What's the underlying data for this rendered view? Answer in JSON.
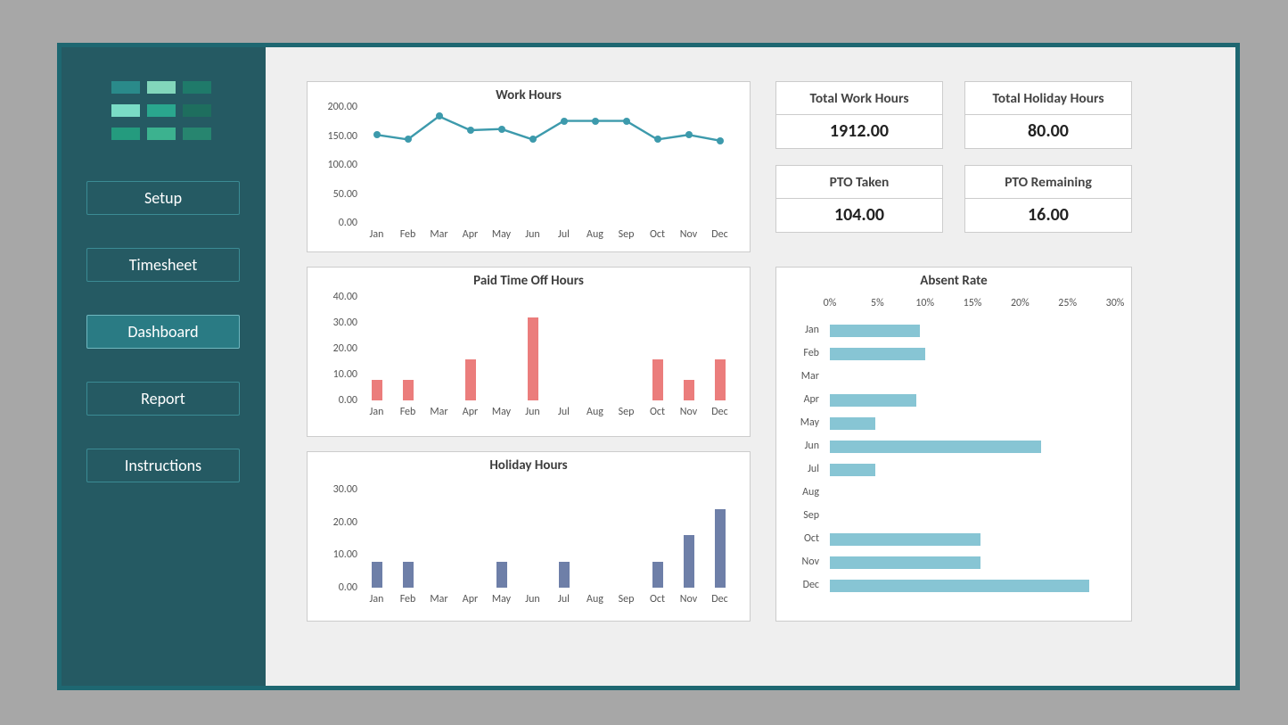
{
  "sidebar": {
    "items": [
      {
        "label": "Setup"
      },
      {
        "label": "Timesheet"
      },
      {
        "label": "Dashboard",
        "active": true
      },
      {
        "label": "Report"
      },
      {
        "label": "Instructions"
      }
    ]
  },
  "kpis": [
    {
      "title": "Total Work Hours",
      "value": "1912.00"
    },
    {
      "title": "Total Holiday Hours",
      "value": "80.00"
    },
    {
      "title": "PTO Taken",
      "value": "104.00"
    },
    {
      "title": "PTO Remaining",
      "value": "16.00"
    }
  ],
  "months": [
    "Jan",
    "Feb",
    "Mar",
    "Apr",
    "May",
    "Jun",
    "Jul",
    "Aug",
    "Sep",
    "Oct",
    "Nov",
    "Dec"
  ],
  "colors": {
    "line": "#3d9aac",
    "pto_bar": "#eb7d7c",
    "holiday_bar": "#6e7fa8",
    "absent_bar": "#87c5d4"
  },
  "chart_data": [
    {
      "type": "line",
      "title": "Work Hours",
      "categories": [
        "Jan",
        "Feb",
        "Mar",
        "Apr",
        "May",
        "Jun",
        "Jul",
        "Aug",
        "Sep",
        "Oct",
        "Nov",
        "Dec"
      ],
      "values": [
        152,
        144,
        184,
        160,
        162,
        144,
        176,
        176,
        176,
        144,
        152,
        142
      ],
      "xlabel": "",
      "ylabel": "",
      "ylim": [
        0,
        200
      ],
      "yticks": [
        0.0,
        50.0,
        100.0,
        150.0,
        200.0
      ]
    },
    {
      "type": "bar",
      "title": "Paid Time Off Hours",
      "categories": [
        "Jan",
        "Feb",
        "Mar",
        "Apr",
        "May",
        "Jun",
        "Jul",
        "Aug",
        "Sep",
        "Oct",
        "Nov",
        "Dec"
      ],
      "values": [
        8,
        8,
        0,
        16,
        0,
        32,
        0,
        0,
        0,
        16,
        8,
        16
      ],
      "xlabel": "",
      "ylabel": "",
      "ylim": [
        0,
        40
      ],
      "yticks": [
        0.0,
        10.0,
        20.0,
        30.0,
        40.0
      ]
    },
    {
      "type": "bar",
      "title": "Holiday Hours",
      "categories": [
        "Jan",
        "Feb",
        "Mar",
        "Apr",
        "May",
        "Jun",
        "Jul",
        "Aug",
        "Sep",
        "Oct",
        "Nov",
        "Dec"
      ],
      "values": [
        8,
        8,
        0,
        0,
        8,
        0,
        8,
        0,
        0,
        8,
        16,
        24
      ],
      "xlabel": "",
      "ylabel": "",
      "ylim": [
        0,
        30
      ],
      "yticks": [
        0.0,
        10.0,
        20.0,
        30.0
      ]
    },
    {
      "type": "bar_horizontal",
      "title": "Absent Rate",
      "categories": [
        "Jan",
        "Feb",
        "Mar",
        "Apr",
        "May",
        "Jun",
        "Jul",
        "Aug",
        "Sep",
        "Oct",
        "Nov",
        "Dec"
      ],
      "values": [
        0.095,
        0.1,
        0.0,
        0.091,
        0.048,
        0.222,
        0.048,
        0.0,
        0.0,
        0.158,
        0.158,
        0.273
      ],
      "xlim": [
        0,
        0.3
      ],
      "xticks": [
        "0%",
        "5%",
        "10%",
        "15%",
        "20%",
        "25%",
        "30%"
      ],
      "xtick_values": [
        0,
        0.05,
        0.1,
        0.15,
        0.2,
        0.25,
        0.3
      ]
    }
  ]
}
